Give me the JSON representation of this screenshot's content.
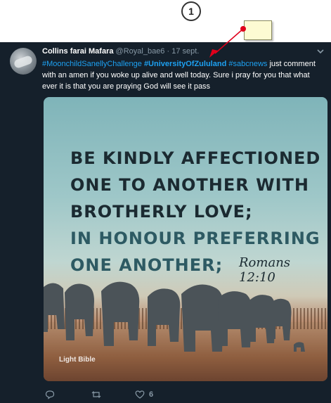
{
  "annotation": {
    "step_number": "1",
    "callout_text": ""
  },
  "tweet": {
    "author_name": "Collins farai Mafara",
    "handle": "@Royal_bae6",
    "separator": "·",
    "date": "17 sept.",
    "text_parts": [
      {
        "type": "hashtag",
        "text": "#MoonchildSanellyChallenge"
      },
      {
        "type": "space",
        "text": " "
      },
      {
        "type": "hashtag_bold",
        "text": "#UniversityOfZululand"
      },
      {
        "type": "space",
        "text": " "
      },
      {
        "type": "hashtag",
        "text": "#sabcnews"
      },
      {
        "type": "text",
        "text": "  just comment with an amen if you woke up alive and well today.    Sure i pray for you that what ever it is that you are praying God will see it pass"
      }
    ],
    "media": {
      "quote_lines": [
        "BE KINDLY AFFECTIONED",
        "ONE TO ANOTHER WITH",
        "BROTHERLY LOVE;",
        "IN HONOUR PREFERRING",
        "ONE ANOTHER;"
      ],
      "reference": "Romans 12:10",
      "logo_text": "Light Bible"
    },
    "actions": {
      "reply_count": "",
      "retweet_count": "",
      "like_count": "6"
    }
  },
  "colors": {
    "background": "#15202b",
    "hashtag": "#1da1f2",
    "muted": "#8899a6",
    "arrow": "#e0001b"
  },
  "icons": [
    "avatar",
    "chevron-down-icon",
    "reply-icon",
    "retweet-icon",
    "heart-icon"
  ]
}
